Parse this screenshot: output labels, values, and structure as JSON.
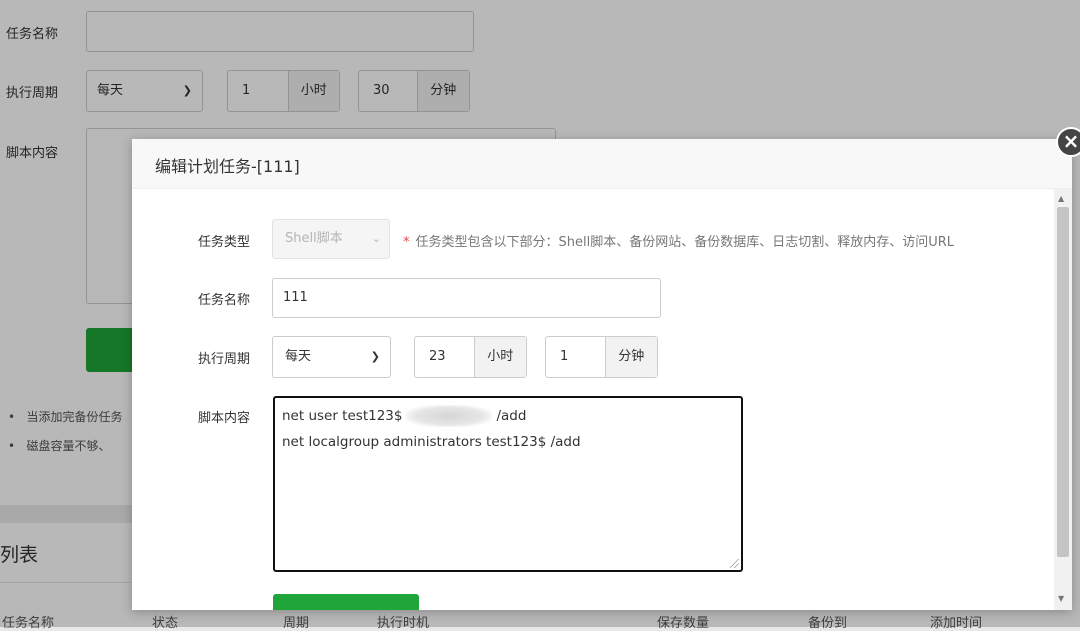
{
  "background_form": {
    "task_name_label": "任务名称",
    "period_label": "执行周期",
    "period_value": "每天",
    "hour_value": "1",
    "hour_unit": "小时",
    "minute_value": "30",
    "minute_unit": "分钟",
    "script_label": "脚本内容",
    "bullets": [
      "当添加完备份任务",
      "磁盘容量不够、"
    ],
    "list_title": "列表",
    "table_headers": [
      "任务名称",
      "状态",
      "周期",
      "执行时机",
      "保存数量",
      "备份到",
      "添加时间"
    ]
  },
  "modal": {
    "title": "编辑计划任务-[111]",
    "close_icon": "close-icon",
    "task_type_label": "任务类型",
    "task_type_value": "Shell脚本",
    "task_type_hint_star": "*",
    "task_type_hint": "任务类型包含以下部分：Shell脚本、备份网站、备份数据库、日志切割、释放内存、访问URL",
    "task_name_label": "任务名称",
    "task_name_value": "111",
    "period_label": "执行周期",
    "period_value": "每天",
    "hour_value": "23",
    "hour_unit": "小时",
    "minute_value": "1",
    "minute_unit": "分钟",
    "script_label": "脚本内容",
    "script_lines": {
      "line1_prefix": "net user test123$",
      "line1_suffix": "/add",
      "line2": "net localgroup administrators test123$ /add"
    }
  },
  "colors": {
    "accent_green": "#20a53a",
    "required_star": "#e54545"
  }
}
